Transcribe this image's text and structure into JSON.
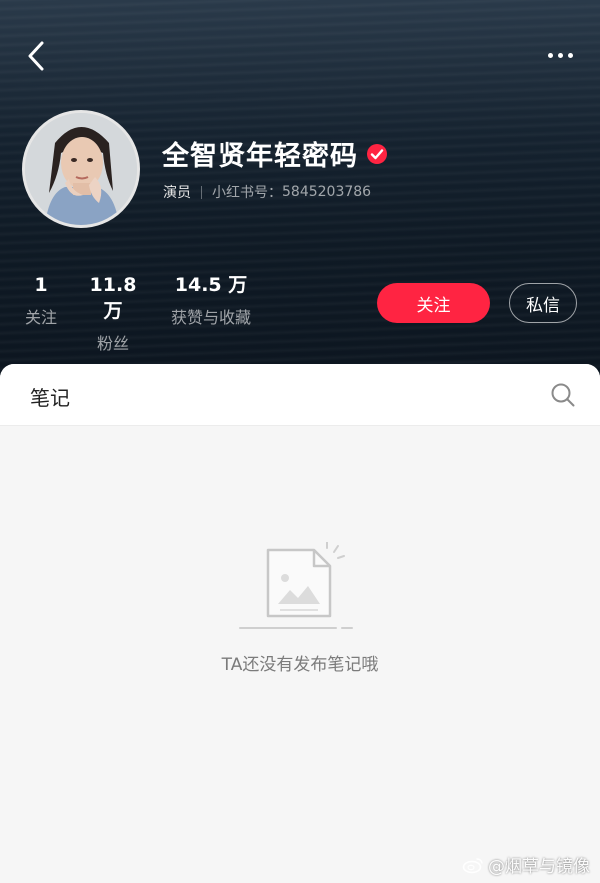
{
  "profile": {
    "name": "全智贤年轻密码",
    "role": "演员",
    "id_label": "小红书号：",
    "id_value": "5845203786"
  },
  "stats": [
    {
      "value": "1",
      "label": "关注"
    },
    {
      "value": "11.8 万",
      "label": "粉丝"
    },
    {
      "value": "14.5 万",
      "label": "获赞与收藏"
    }
  ],
  "actions": {
    "follow_label": "关注",
    "message_label": "私信"
  },
  "tabs": {
    "notes_label": "笔记"
  },
  "empty": {
    "text": "TA还没有发布笔记哦"
  },
  "watermark": {
    "text": "@烟草与镜像"
  },
  "colors": {
    "accent": "#ff2442",
    "header_bg": "#0f1a25",
    "panel_bg": "#f6f6f6"
  },
  "icons": [
    "back-arrow-icon",
    "more-dots-icon",
    "verified-icon",
    "search-icon",
    "empty-document-icon",
    "weibo-icon"
  ]
}
